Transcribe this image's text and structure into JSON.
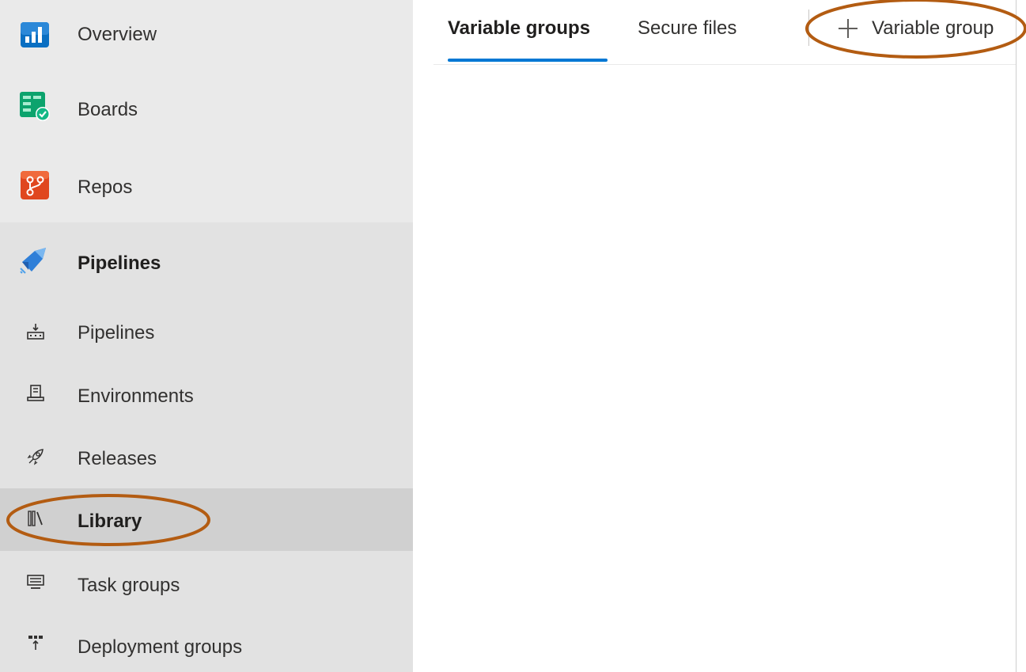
{
  "sidebar": {
    "top_items": [
      {
        "label": "Overview",
        "icon": "overview-icon"
      },
      {
        "label": "Boards",
        "icon": "boards-icon"
      },
      {
        "label": "Repos",
        "icon": "repos-icon"
      }
    ],
    "section": {
      "label": "Pipelines",
      "icon": "pipelines-section-icon"
    },
    "sub_items": [
      {
        "label": "Pipelines",
        "icon": "pipelines-icon"
      },
      {
        "label": "Environments",
        "icon": "environments-icon"
      },
      {
        "label": "Releases",
        "icon": "rocket-icon"
      },
      {
        "label": "Library",
        "icon": "library-icon",
        "selected": true
      },
      {
        "label": "Task groups",
        "icon": "task-groups-icon"
      },
      {
        "label": "Deployment groups",
        "icon": "deployment-groups-icon"
      }
    ]
  },
  "main": {
    "tabs": [
      {
        "label": "Variable groups",
        "active": true
      },
      {
        "label": "Secure files",
        "active": false
      }
    ],
    "add_button_label": "Variable group"
  },
  "colors": {
    "accent": "#0078d4",
    "annotation": "#b35c12",
    "sidebar_bg": "#eaeaea",
    "selected_bg": "#d0d0d0"
  }
}
